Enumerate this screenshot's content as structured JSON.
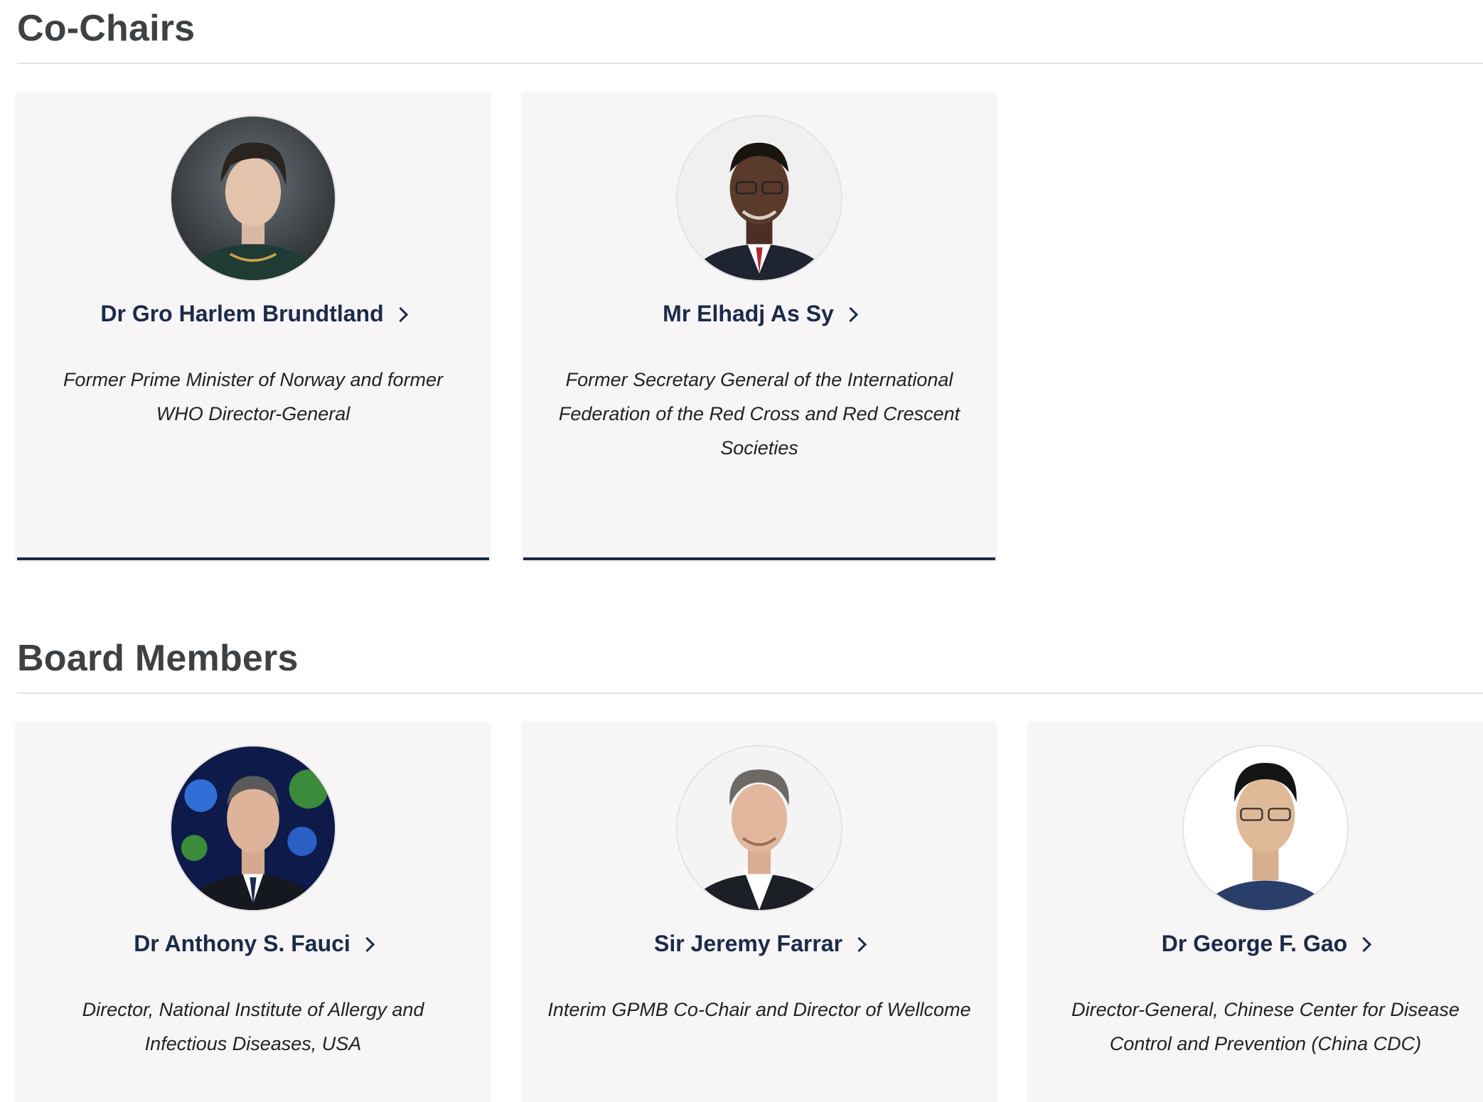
{
  "cochairs": {
    "title": "Co-Chairs",
    "members": [
      {
        "name": "Dr Gro Harlem Brundtland",
        "role": "Former Prime Minister of Norway and former WHO Director-General",
        "photo_icon": "portrait-brundtland"
      },
      {
        "name": "Mr Elhadj As Sy",
        "role": "Former Secretary General of the International Federation of the Red Cross and Red Crescent Societies",
        "photo_icon": "portrait-sy"
      }
    ]
  },
  "board": {
    "title": "Board Members",
    "members": [
      {
        "name": "Dr Anthony S. Fauci",
        "role": "Director, National Institute of Allergy and Infectious Diseases, USA",
        "photo_icon": "portrait-fauci"
      },
      {
        "name": "Sir Jeremy Farrar",
        "role": "Interim GPMB Co-Chair and Director of Wellcome",
        "photo_icon": "portrait-farrar"
      },
      {
        "name": "Dr George F. Gao",
        "role": "Director-General, Chinese Center for Disease Control and Prevention (China CDC)",
        "photo_icon": "portrait-gao"
      }
    ]
  },
  "colors": {
    "heading": "#3d4144",
    "name_link": "#1c2a4a",
    "card_bg": "#f7f5f5",
    "card_accent_border": "#1c2a4a"
  }
}
